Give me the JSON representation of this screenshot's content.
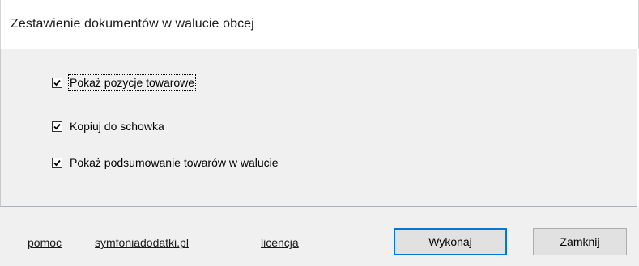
{
  "window": {
    "title": "Zestawienie dokumentów w walucie obcej"
  },
  "options": [
    {
      "label": "Pokaż pozycje towarowe",
      "checked": true
    },
    {
      "label": "Kopiuj do schowka",
      "checked": true
    },
    {
      "label": "Pokaż podsumowanie towarów w walucie",
      "checked": true
    }
  ],
  "footer": {
    "links": {
      "help": "pomoc",
      "website": "symfoniadodatki.pl",
      "license": "licencja"
    },
    "buttons": {
      "execute": "Wykonaj",
      "close": "Zamknij"
    }
  },
  "colors": {
    "panel_bg": "#f0f0f0",
    "button_bg": "#e1e1e1",
    "focus_border": "#0078d7"
  }
}
